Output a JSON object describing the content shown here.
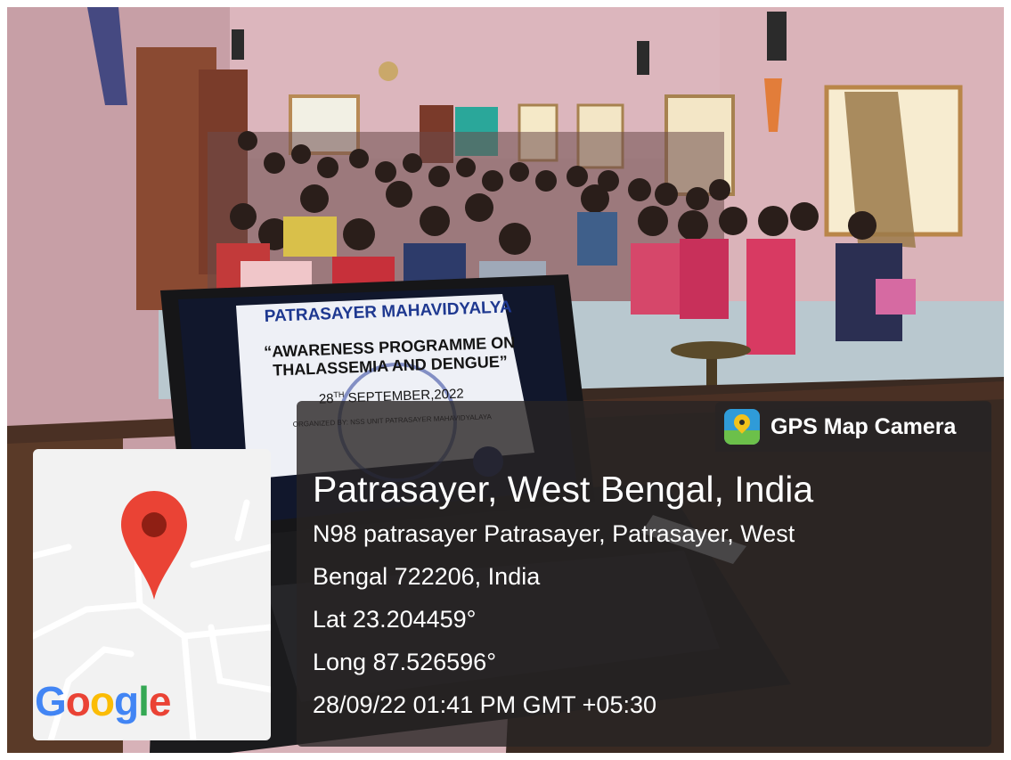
{
  "watermark": {
    "app_name": "GPS Map Camera",
    "place": "Patrasayer, West Bengal, India",
    "address_line1": "N98 patrasayer Patrasayer, Patrasayer, West",
    "address_line2": "Bengal 722206, India",
    "latitude": "Lat 23.204459°",
    "longitude": "Long 87.526596°",
    "datetime": "28/09/22 01:41 PM GMT +05:30"
  },
  "map": {
    "logo_text": "Google",
    "logo_letters": [
      "G",
      "o",
      "o",
      "g",
      "l",
      "e"
    ],
    "logo_colors": [
      "#4285F4",
      "#EA4335",
      "#FBBC05",
      "#4285F4",
      "#34A853",
      "#EA4335"
    ],
    "pin_icon": "map-pin-icon",
    "pin_color": "#EA4335"
  },
  "laptop_screen": {
    "title": "PATRASAYER MAHAVIDYALYA",
    "event_line1": "“AWARENESS PROGRAMME ON",
    "event_line2": "THALASSEMIA AND DENGUE”",
    "date_day": "28",
    "date_sup": "TH",
    "date_rest": " SEPTEMBER,2022",
    "organized_by": "ORGANIZED BY: NSS UNIT PATRASAYER MAHAVIDYALAYA"
  }
}
